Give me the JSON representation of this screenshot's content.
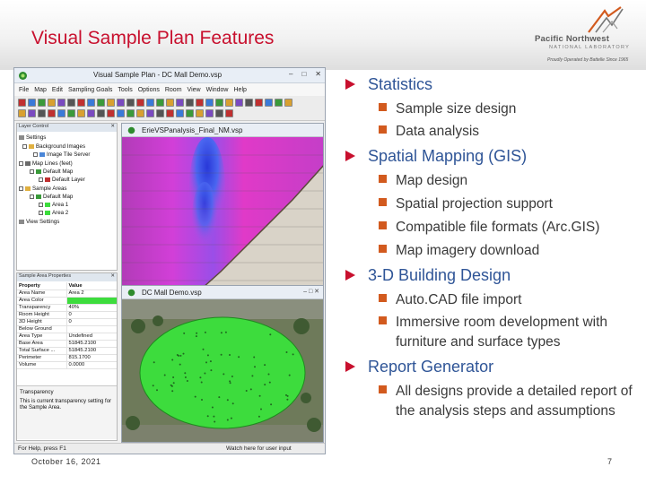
{
  "slide": {
    "title": "Visual Sample Plan Features",
    "date": "October 16, 2021",
    "page_number": "7"
  },
  "logo": {
    "name": "Pacific Northwest",
    "sub": "NATIONAL LABORATORY",
    "tagline": "Proudly Operated by Battelle Since 1965"
  },
  "app": {
    "title": "Visual Sample Plan - DC Mall Demo.vsp",
    "window_buttons": [
      "–",
      "□",
      "✕"
    ],
    "menu": [
      "File",
      "Map",
      "Edit",
      "Sampling Goals",
      "Tools",
      "Options",
      "Room",
      "View",
      "Window",
      "Help"
    ],
    "layer_panel": {
      "header": "Layer Control",
      "items": [
        {
          "label": "Settings"
        },
        {
          "label": "Background Images"
        },
        {
          "label": "Image Tile Server"
        },
        {
          "label": "Map Lines (feet)"
        },
        {
          "label": "Default Map"
        },
        {
          "label": "Default Layer"
        },
        {
          "label": "Sample Areas"
        },
        {
          "label": "Default Map"
        },
        {
          "label": "Area 1"
        },
        {
          "label": "Area 2"
        },
        {
          "label": "View Settings"
        }
      ]
    },
    "props_panel": {
      "header": "Sample Area Properties",
      "rows": [
        {
          "key": "Property",
          "value": "Value"
        },
        {
          "key": "Area Name",
          "value": "Area 2"
        },
        {
          "key": "Area Color",
          "value": ""
        },
        {
          "key": "Transparency",
          "value": "40%"
        },
        {
          "key": "Room Height",
          "value": "0"
        },
        {
          "key": "3D Height",
          "value": "0"
        },
        {
          "key": "Below Ground",
          "value": ""
        },
        {
          "key": "Area Type",
          "value": "Undefined"
        },
        {
          "key": "Base Area",
          "value": "51845.2100"
        },
        {
          "key": "Total Surface ...",
          "value": "51845.2100"
        },
        {
          "key": "Perimeter",
          "value": "815.1700"
        },
        {
          "key": "Volume",
          "value": "0.0000"
        }
      ],
      "desc_title": "Transparency",
      "desc_body": "This is current transparency setting for the Sample Area."
    },
    "map1_title": "ErieVSPanalysis_Final_NM.vsp",
    "map2_title": "DC Mall Demo.vsp",
    "status_left": "For Help, press F1",
    "status_right": "Watch here for user input",
    "colors": {
      "area_green": "#3ddc3d",
      "heat_magenta": "#d13ad1",
      "heat_blue": "#3a55e0"
    }
  },
  "bullets": [
    {
      "label": "Statistics",
      "children": [
        "Sample size design",
        "Data analysis"
      ]
    },
    {
      "label": "Spatial Mapping (GIS)",
      "children": [
        "Map design",
        "Spatial projection support",
        "Compatible file formats (Arc.GIS)",
        "Map imagery download"
      ]
    },
    {
      "label": "3-D Building Design",
      "children": [
        "Auto.CAD file import",
        "Immersive room development with furniture and surface types"
      ]
    },
    {
      "label": "Report Generator",
      "children": [
        "All designs provide a detailed report of the analysis steps and assumptions"
      ]
    }
  ],
  "accent_colors": {
    "title_red": "#c8102e",
    "bullet_blue": "#2f5597",
    "square_orange": "#d25a1e"
  }
}
